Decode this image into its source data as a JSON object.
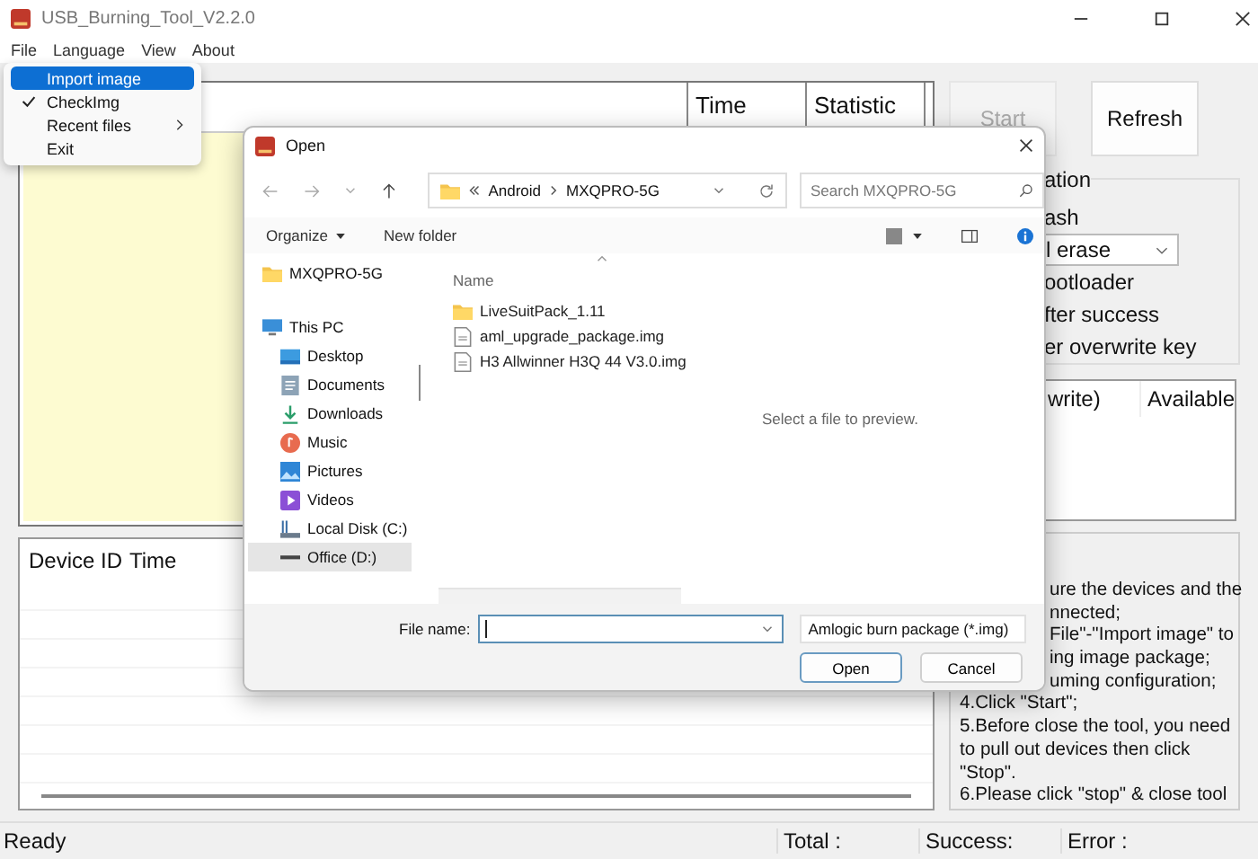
{
  "window": {
    "title": "USB_Burning_Tool_V2.2.0"
  },
  "menu_bar": [
    "File",
    "Language",
    "View",
    "About"
  ],
  "file_menu": [
    {
      "label": "Import image",
      "selected": true,
      "checked": false,
      "submenu": false
    },
    {
      "label": "CheckImg",
      "selected": false,
      "checked": true,
      "submenu": false
    },
    {
      "label": "Recent files",
      "selected": false,
      "checked": false,
      "submenu": true
    },
    {
      "label": "Exit",
      "selected": false,
      "checked": false,
      "submenu": false
    }
  ],
  "progress_table": {
    "columns": [
      "Time",
      "Statistic"
    ]
  },
  "buttons": [
    {
      "label": "Start",
      "disabled": true
    },
    {
      "label": "Refresh",
      "disabled": false
    }
  ],
  "configuration": {
    "title": "ation",
    "items": [
      {
        "kind": "label",
        "text": "ash"
      },
      {
        "kind": "select",
        "text": "l erase"
      },
      {
        "kind": "label",
        "text": "ootloader"
      },
      {
        "kind": "label",
        "text": "fter success"
      },
      {
        "kind": "label",
        "text": "er overwrite key"
      }
    ]
  },
  "device_table": {
    "columns": [
      "write)",
      "Available"
    ]
  },
  "instructions": {
    "partial_lines": [
      "ure the devices and the",
      "nnected;",
      "File\"-\"Import image\" to",
      "ing image package;",
      "uming configuration;"
    ],
    "lines": [
      "4.Click \"Start\";",
      "5.Before close the tool, you need to pull out devices then click \"Stop\".",
      "6.Please click \"stop\" & close tool"
    ]
  },
  "log_table": {
    "columns": [
      "Device ID",
      "Time"
    ]
  },
  "status_bar": {
    "status": "Ready",
    "total": "Total :",
    "success": "Success:",
    "error": "Error :"
  },
  "open_dialog": {
    "title": "Open",
    "path": [
      "Android",
      "MXQPRO-5G"
    ],
    "search": {
      "placeholder": "Search MXQPRO-5G"
    },
    "toolbar": [
      {
        "label": "Organize",
        "dropdown": true
      },
      {
        "label": "New folder",
        "dropdown": false
      }
    ],
    "nav_pane": [
      {
        "children": [
          {
            "label": "MXQPRO-5G",
            "kind": "folder",
            "selected": false
          }
        ]
      },
      {
        "label": "This PC",
        "kind": "pc",
        "selected": false,
        "children": [
          {
            "label": "Desktop",
            "kind": "desktop",
            "selected": false
          },
          {
            "label": "Documents",
            "kind": "documents",
            "selected": false
          },
          {
            "label": "Downloads",
            "kind": "downloads",
            "selected": false
          },
          {
            "label": "Music",
            "kind": "music",
            "selected": false
          },
          {
            "label": "Pictures",
            "kind": "pictures",
            "selected": false
          },
          {
            "label": "Videos",
            "kind": "videos",
            "selected": false
          },
          {
            "label": "Local Disk (C:)",
            "kind": "disk",
            "selected": false
          },
          {
            "label": "Office (D:)",
            "kind": "drive",
            "selected": true
          }
        ]
      }
    ],
    "list_column": "Name",
    "files": [
      {
        "name": "LiveSuitPack_1.11",
        "kind": "folder"
      },
      {
        "name": "aml_upgrade_package.img",
        "kind": "file"
      },
      {
        "name": "H3 Allwinner H3Q 44 V3.0.img",
        "kind": "file"
      }
    ],
    "preview_message": "Select a file to preview.",
    "file_name_label": "File name:",
    "file_type": "Amlogic burn package (*.img)",
    "buttons": [
      {
        "label": "Open",
        "default": true
      },
      {
        "label": "Cancel",
        "default": false
      }
    ]
  }
}
